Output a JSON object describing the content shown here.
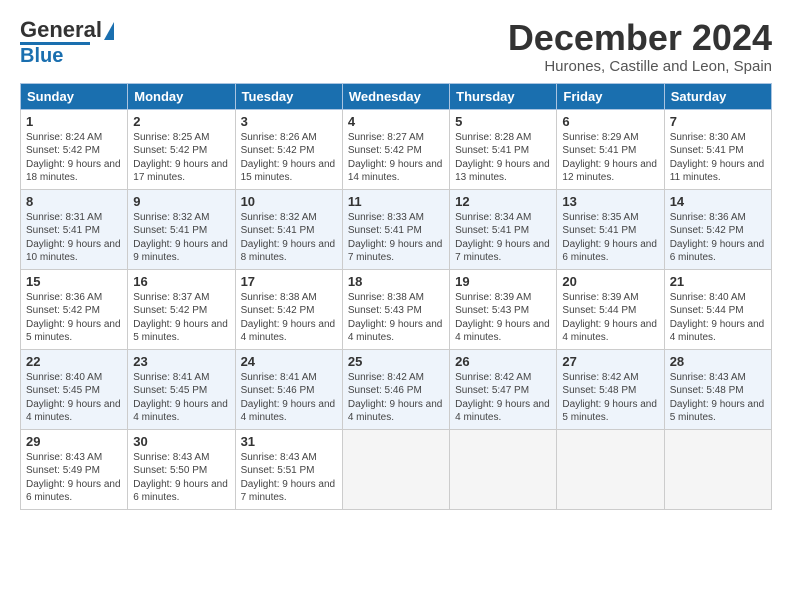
{
  "logo": {
    "line1": "General",
    "line2": "Blue"
  },
  "title": "December 2024",
  "subtitle": "Hurones, Castille and Leon, Spain",
  "days": [
    "Sunday",
    "Monday",
    "Tuesday",
    "Wednesday",
    "Thursday",
    "Friday",
    "Saturday"
  ],
  "weeks": [
    [
      {
        "day": "1",
        "rise": "8:24 AM",
        "set": "5:42 PM",
        "daylight": "9 hours and 18 minutes."
      },
      {
        "day": "2",
        "rise": "8:25 AM",
        "set": "5:42 PM",
        "daylight": "9 hours and 17 minutes."
      },
      {
        "day": "3",
        "rise": "8:26 AM",
        "set": "5:42 PM",
        "daylight": "9 hours and 15 minutes."
      },
      {
        "day": "4",
        "rise": "8:27 AM",
        "set": "5:42 PM",
        "daylight": "9 hours and 14 minutes."
      },
      {
        "day": "5",
        "rise": "8:28 AM",
        "set": "5:41 PM",
        "daylight": "9 hours and 13 minutes."
      },
      {
        "day": "6",
        "rise": "8:29 AM",
        "set": "5:41 PM",
        "daylight": "9 hours and 12 minutes."
      },
      {
        "day": "7",
        "rise": "8:30 AM",
        "set": "5:41 PM",
        "daylight": "9 hours and 11 minutes."
      }
    ],
    [
      {
        "day": "8",
        "rise": "8:31 AM",
        "set": "5:41 PM",
        "daylight": "9 hours and 10 minutes."
      },
      {
        "day": "9",
        "rise": "8:32 AM",
        "set": "5:41 PM",
        "daylight": "9 hours and 9 minutes."
      },
      {
        "day": "10",
        "rise": "8:32 AM",
        "set": "5:41 PM",
        "daylight": "9 hours and 8 minutes."
      },
      {
        "day": "11",
        "rise": "8:33 AM",
        "set": "5:41 PM",
        "daylight": "9 hours and 7 minutes."
      },
      {
        "day": "12",
        "rise": "8:34 AM",
        "set": "5:41 PM",
        "daylight": "9 hours and 7 minutes."
      },
      {
        "day": "13",
        "rise": "8:35 AM",
        "set": "5:41 PM",
        "daylight": "9 hours and 6 minutes."
      },
      {
        "day": "14",
        "rise": "8:36 AM",
        "set": "5:42 PM",
        "daylight": "9 hours and 6 minutes."
      }
    ],
    [
      {
        "day": "15",
        "rise": "8:36 AM",
        "set": "5:42 PM",
        "daylight": "9 hours and 5 minutes."
      },
      {
        "day": "16",
        "rise": "8:37 AM",
        "set": "5:42 PM",
        "daylight": "9 hours and 5 minutes."
      },
      {
        "day": "17",
        "rise": "8:38 AM",
        "set": "5:42 PM",
        "daylight": "9 hours and 4 minutes."
      },
      {
        "day": "18",
        "rise": "8:38 AM",
        "set": "5:43 PM",
        "daylight": "9 hours and 4 minutes."
      },
      {
        "day": "19",
        "rise": "8:39 AM",
        "set": "5:43 PM",
        "daylight": "9 hours and 4 minutes."
      },
      {
        "day": "20",
        "rise": "8:39 AM",
        "set": "5:44 PM",
        "daylight": "9 hours and 4 minutes."
      },
      {
        "day": "21",
        "rise": "8:40 AM",
        "set": "5:44 PM",
        "daylight": "9 hours and 4 minutes."
      }
    ],
    [
      {
        "day": "22",
        "rise": "8:40 AM",
        "set": "5:45 PM",
        "daylight": "9 hours and 4 minutes."
      },
      {
        "day": "23",
        "rise": "8:41 AM",
        "set": "5:45 PM",
        "daylight": "9 hours and 4 minutes."
      },
      {
        "day": "24",
        "rise": "8:41 AM",
        "set": "5:46 PM",
        "daylight": "9 hours and 4 minutes."
      },
      {
        "day": "25",
        "rise": "8:42 AM",
        "set": "5:46 PM",
        "daylight": "9 hours and 4 minutes."
      },
      {
        "day": "26",
        "rise": "8:42 AM",
        "set": "5:47 PM",
        "daylight": "9 hours and 4 minutes."
      },
      {
        "day": "27",
        "rise": "8:42 AM",
        "set": "5:48 PM",
        "daylight": "9 hours and 5 minutes."
      },
      {
        "day": "28",
        "rise": "8:43 AM",
        "set": "5:48 PM",
        "daylight": "9 hours and 5 minutes."
      }
    ],
    [
      {
        "day": "29",
        "rise": "8:43 AM",
        "set": "5:49 PM",
        "daylight": "9 hours and 6 minutes."
      },
      {
        "day": "30",
        "rise": "8:43 AM",
        "set": "5:50 PM",
        "daylight": "9 hours and 6 minutes."
      },
      {
        "day": "31",
        "rise": "8:43 AM",
        "set": "5:51 PM",
        "daylight": "9 hours and 7 minutes."
      },
      null,
      null,
      null,
      null
    ]
  ]
}
